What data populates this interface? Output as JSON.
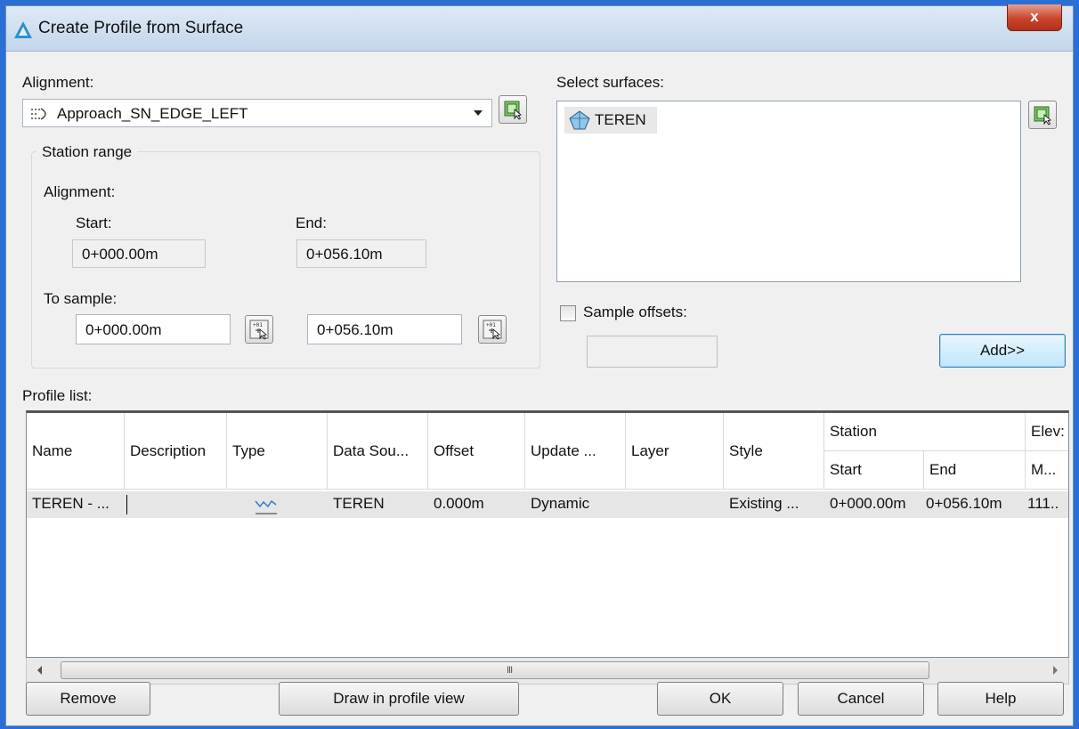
{
  "window": {
    "title": "Create Profile from Surface",
    "close": "x"
  },
  "alignment": {
    "label": "Alignment:",
    "selected": "Approach_SN_EDGE_LEFT"
  },
  "station_range": {
    "title": "Station range",
    "alignment_label": "Alignment:",
    "start_label": "Start:",
    "end_label": "End:",
    "start_value": "0+000.00m",
    "end_value": "0+056.10m",
    "to_sample_label": "To sample:",
    "sample_start": "0+000.00m",
    "sample_end": "0+056.10m"
  },
  "surfaces": {
    "label": "Select surfaces:",
    "items": [
      "TEREN"
    ]
  },
  "sample_offsets": {
    "label": "Sample offsets:",
    "checked": false,
    "value": ""
  },
  "add_button": "Add>>",
  "profile_list": {
    "label": "Profile list:",
    "columns": [
      "Name",
      "Description",
      "Type",
      "Data Sou...",
      "Offset",
      "Update ...",
      "Layer",
      "Style"
    ],
    "station_group": "Station",
    "station_sub": [
      "Start",
      "End"
    ],
    "elevation_group": "Elev:",
    "elevation_sub": "M...",
    "rows": [
      {
        "name": "TEREN - ...",
        "description": "",
        "type_icon": "profile-line-icon",
        "data_source": "TEREN",
        "offset": "0.000m",
        "update": "Dynamic",
        "layer": "",
        "style": "Existing ...",
        "start": "0+000.00m",
        "end": "0+056.10m",
        "elevation": "111.."
      }
    ]
  },
  "scrollbar": {
    "grip": "III"
  },
  "buttons": {
    "remove": "Remove",
    "draw": "Draw in profile view",
    "ok": "OK",
    "cancel": "Cancel",
    "help": "Help"
  }
}
